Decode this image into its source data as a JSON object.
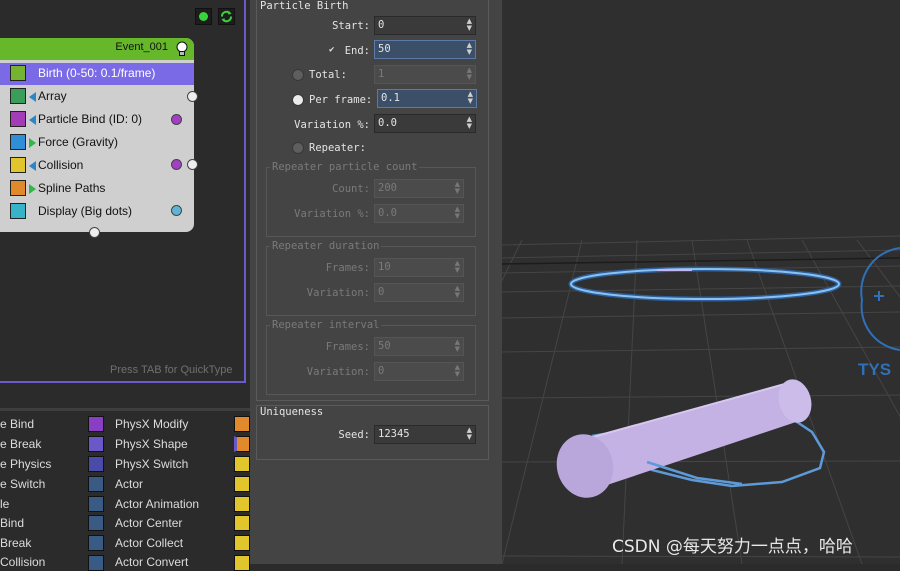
{
  "graph": {
    "event_title": "Event_001",
    "operators": [
      {
        "label": "Birth (0-50: 0.1/frame)",
        "icon": "birth-icon"
      },
      {
        "label": "Array",
        "icon": "array-icon"
      },
      {
        "label": "Particle Bind (ID: 0)",
        "icon": "particle-bind-icon"
      },
      {
        "label": "Force (Gravity)",
        "icon": "force-icon"
      },
      {
        "label": "Collision",
        "icon": "collision-icon"
      },
      {
        "label": "Spline Paths",
        "icon": "spline-paths-icon"
      },
      {
        "label": "Display (Big dots)",
        "icon": "display-icon"
      }
    ],
    "quicktype_hint": "Press TAB for QuickType"
  },
  "depot": {
    "col1": [
      "e Bind",
      "e Break",
      "e Physics",
      "e Switch",
      "le",
      " Bind",
      " Break",
      " Collision"
    ],
    "col2": [
      "PhysX Modify",
      "PhysX Shape",
      "PhysX Switch",
      "Actor",
      "Actor Animation",
      "Actor Center",
      "Actor Collect",
      "Actor Convert"
    ]
  },
  "particle_birth": {
    "title": "Particle Birth",
    "start_label": "Start:",
    "start_value": "0",
    "end_label": "End:",
    "end_value": "50",
    "end_check": "✔",
    "total_label": "Total:",
    "total_value": "1",
    "per_frame_label": "Per frame:",
    "per_frame_value": "0.1",
    "variation_label": "Variation %:",
    "variation_value": "0.0",
    "repeater_label": "Repeater:",
    "rep_count": {
      "title": "Repeater particle count",
      "count_label": "Count:",
      "count_value": "200",
      "var_label": "Variation %:",
      "var_value": "0.0"
    },
    "rep_duration": {
      "title": "Repeater duration",
      "frames_label": "Frames:",
      "frames_value": "10",
      "var_label": "Variation:",
      "var_value": "0"
    },
    "rep_interval": {
      "title": "Repeater interval",
      "frames_label": "Frames:",
      "frames_value": "50",
      "var_label": "Variation:",
      "var_value": "0"
    }
  },
  "uniqueness": {
    "title": "Uniqueness",
    "seed_label": "Seed:",
    "seed_value": "12345"
  },
  "viewport": {
    "gizmo_text": "TYS",
    "watermark": "CSDN @每天努力一点点，哈哈"
  },
  "colors": {
    "event_header": "#66b82a",
    "selected_row": "#7b6ae6",
    "panel_bg": "#444444",
    "highlight_field": "#3b4f69",
    "cylinder": "#c7b4e6"
  }
}
